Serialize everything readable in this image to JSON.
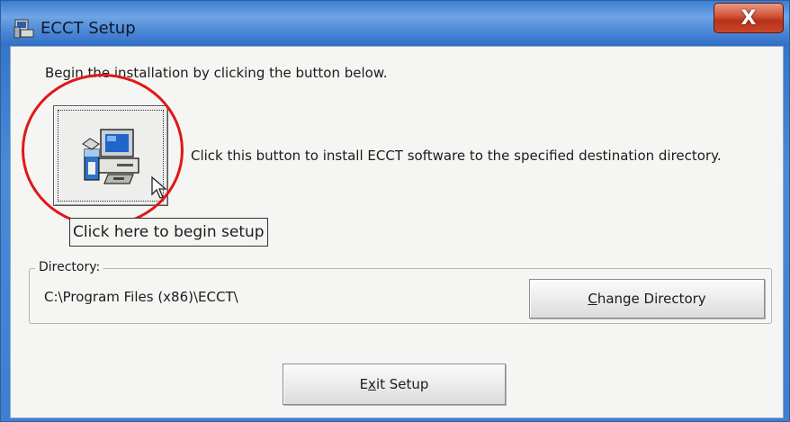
{
  "window": {
    "title": "ECCT Setup",
    "close_label": "X",
    "title_icon": "setup-computer-icon"
  },
  "main": {
    "intro_text": "Begin the installation by clicking the button below.",
    "install_button_icon": "install-computer-icon",
    "install_description": "Click this button to install ECCT software to the specified destination directory.",
    "begin_label": "Click here to begin setup"
  },
  "directory": {
    "legend": "Directory:",
    "path": "C:\\Program Files (x86)\\ECCT\\",
    "change_button": {
      "mnemonic": "C",
      "rest": "hange Directory"
    }
  },
  "footer": {
    "exit_button": {
      "prefix": "E",
      "mnemonic": "x",
      "rest": "it Setup"
    }
  },
  "colors": {
    "title_bar": "#4b86d6",
    "close_button": "#c9462a",
    "highlight_circle": "#e01818"
  }
}
